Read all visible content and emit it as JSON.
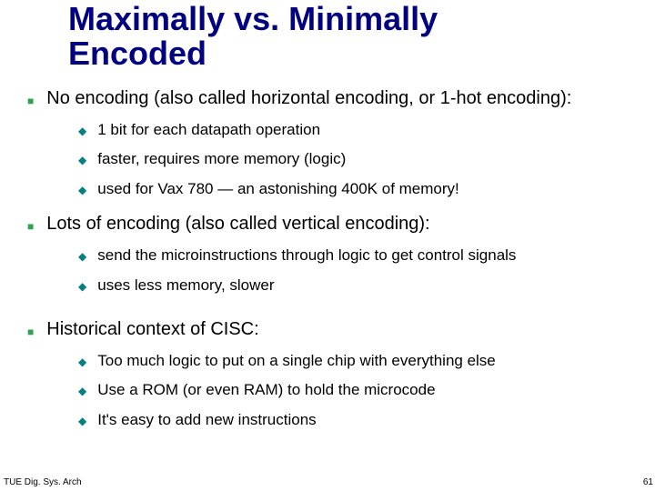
{
  "title_line1": "Maximally vs. Minimally",
  "title_line2": "Encoded",
  "sections": [
    {
      "heading": "No encoding (also called horizontal encoding, or 1-hot encoding):",
      "items": [
        "1 bit for each datapath operation",
        "faster, requires more memory (logic)",
        "used for Vax 780 — an astonishing 400K of memory!"
      ]
    },
    {
      "heading": "Lots of encoding (also called vertical encoding):",
      "items": [
        "send the microinstructions through logic to get control signals",
        "uses less memory, slower"
      ]
    },
    {
      "heading": "Historical context of CISC:",
      "items": [
        "Too much logic to put on a single chip with everything else",
        "Use a ROM (or even RAM) to hold the microcode",
        "It's easy to add new instructions"
      ]
    }
  ],
  "footer_left": "TUE Dig. Sys. Arch",
  "footer_right": "61"
}
